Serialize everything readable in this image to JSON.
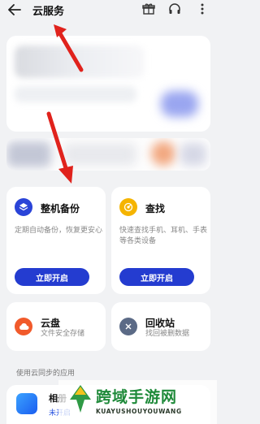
{
  "header": {
    "title": "云服务",
    "icons": [
      "back-arrow-icon",
      "gift-icon",
      "headset-icon",
      "more-vertical-icon"
    ]
  },
  "cards": {
    "backup": {
      "title": "整机备份",
      "desc": "定期自动备份，恢复更安心",
      "button": "立即开启",
      "icon": "layers-icon",
      "color": "#2a44d8"
    },
    "find": {
      "title": "查找",
      "desc": "快速查找手机、耳机、手表等各类设备",
      "button": "立即开启",
      "icon": "radar-icon",
      "color": "#f5b400"
    },
    "drive": {
      "title": "云盘",
      "desc": "文件安全存储",
      "icon": "cloud-icon",
      "color": "#f15a2b"
    },
    "trash": {
      "title": "回收站",
      "desc": "找回被删数据",
      "icon": "recycle-icon",
      "color": "#5b6a86"
    }
  },
  "section": {
    "label": "使用云同步的应用"
  },
  "app": {
    "name": "相册",
    "status": "未开启"
  },
  "watermark": {
    "text": "跨域手游网",
    "sub": "KUAYUSHOUYOUWANG"
  },
  "colors": {
    "accent": "#243cd0",
    "background": "#f1f2f4",
    "annotation_arrow": "#e0221c"
  }
}
